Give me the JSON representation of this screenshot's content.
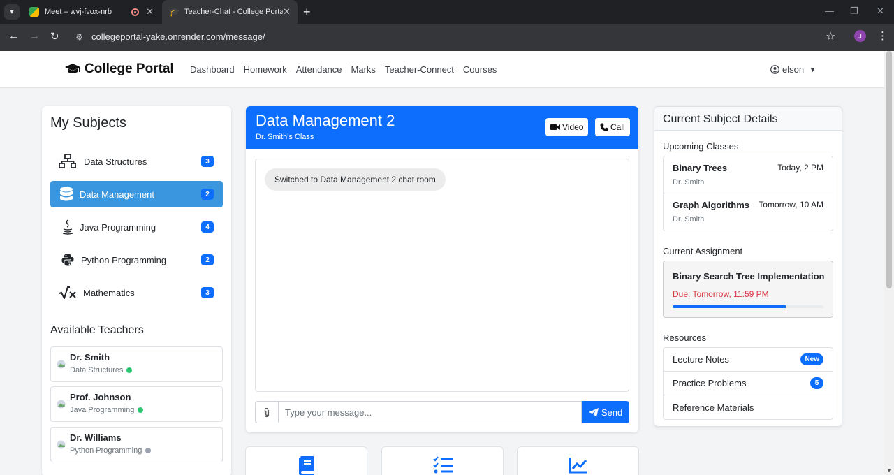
{
  "browser": {
    "tabs": [
      {
        "title": "Meet – wvj-fvox-nrb",
        "active": false
      },
      {
        "title": "Teacher-Chat - College Portal",
        "active": true
      }
    ],
    "url": "collegeportal-yake.onrender.com/message/",
    "profile_initial": "J"
  },
  "navbar": {
    "brand": "College Portal",
    "links": [
      "Dashboard",
      "Homework",
      "Attendance",
      "Marks",
      "Teacher-Connect",
      "Courses"
    ],
    "user": "elson"
  },
  "subjects": {
    "title": "My Subjects",
    "items": [
      {
        "label": "Data Structures",
        "count": "3",
        "icon": "sitemap-icon",
        "active": false
      },
      {
        "label": "Data Management",
        "count": "2",
        "icon": "database-icon",
        "active": true
      },
      {
        "label": "Java Programming",
        "count": "4",
        "icon": "java-icon",
        "active": false
      },
      {
        "label": "Python Programming",
        "count": "2",
        "icon": "python-icon",
        "active": false
      },
      {
        "label": "Mathematics",
        "count": "3",
        "icon": "square-root-icon",
        "active": false
      }
    ]
  },
  "teachers": {
    "title": "Available Teachers",
    "items": [
      {
        "name": "Dr. Smith",
        "subject": "Data Structures",
        "status": "online",
        "status_color": "#28c76f"
      },
      {
        "name": "Prof. Johnson",
        "subject": "Java Programming",
        "status": "online",
        "status_color": "#28c76f"
      },
      {
        "name": "Dr. Williams",
        "subject": "Python Programming",
        "status": "offline",
        "status_color": "#9ca3af"
      }
    ]
  },
  "chat": {
    "title": "Data Management 2",
    "subtitle": "Dr. Smith's Class",
    "video_label": "Video",
    "call_label": "Call",
    "messages": [
      "Switched to Data Management 2 chat room"
    ],
    "input_placeholder": "Type your message...",
    "send_label": "Send"
  },
  "details": {
    "title": "Current Subject Details",
    "upcoming_title": "Upcoming Classes",
    "classes": [
      {
        "name": "Binary Trees",
        "time": "Today, 2 PM",
        "teacher": "Dr. Smith"
      },
      {
        "name": "Graph Algorithms",
        "time": "Tomorrow, 10 AM",
        "teacher": "Dr. Smith"
      }
    ],
    "assignment_title": "Current Assignment",
    "assignment": {
      "name": "Binary Search Tree Implementation",
      "due": "Due: Tomorrow, 11:59 PM",
      "progress": 0.75
    },
    "resources_title": "Resources",
    "resources": [
      {
        "label": "Lecture Notes",
        "badge": "New"
      },
      {
        "label": "Practice Problems",
        "badge": "5"
      },
      {
        "label": "Reference Materials",
        "badge": ""
      }
    ]
  },
  "colors": {
    "primary": "#0d6efd",
    "active_subject": "#3a97df",
    "danger": "#dc3545"
  }
}
